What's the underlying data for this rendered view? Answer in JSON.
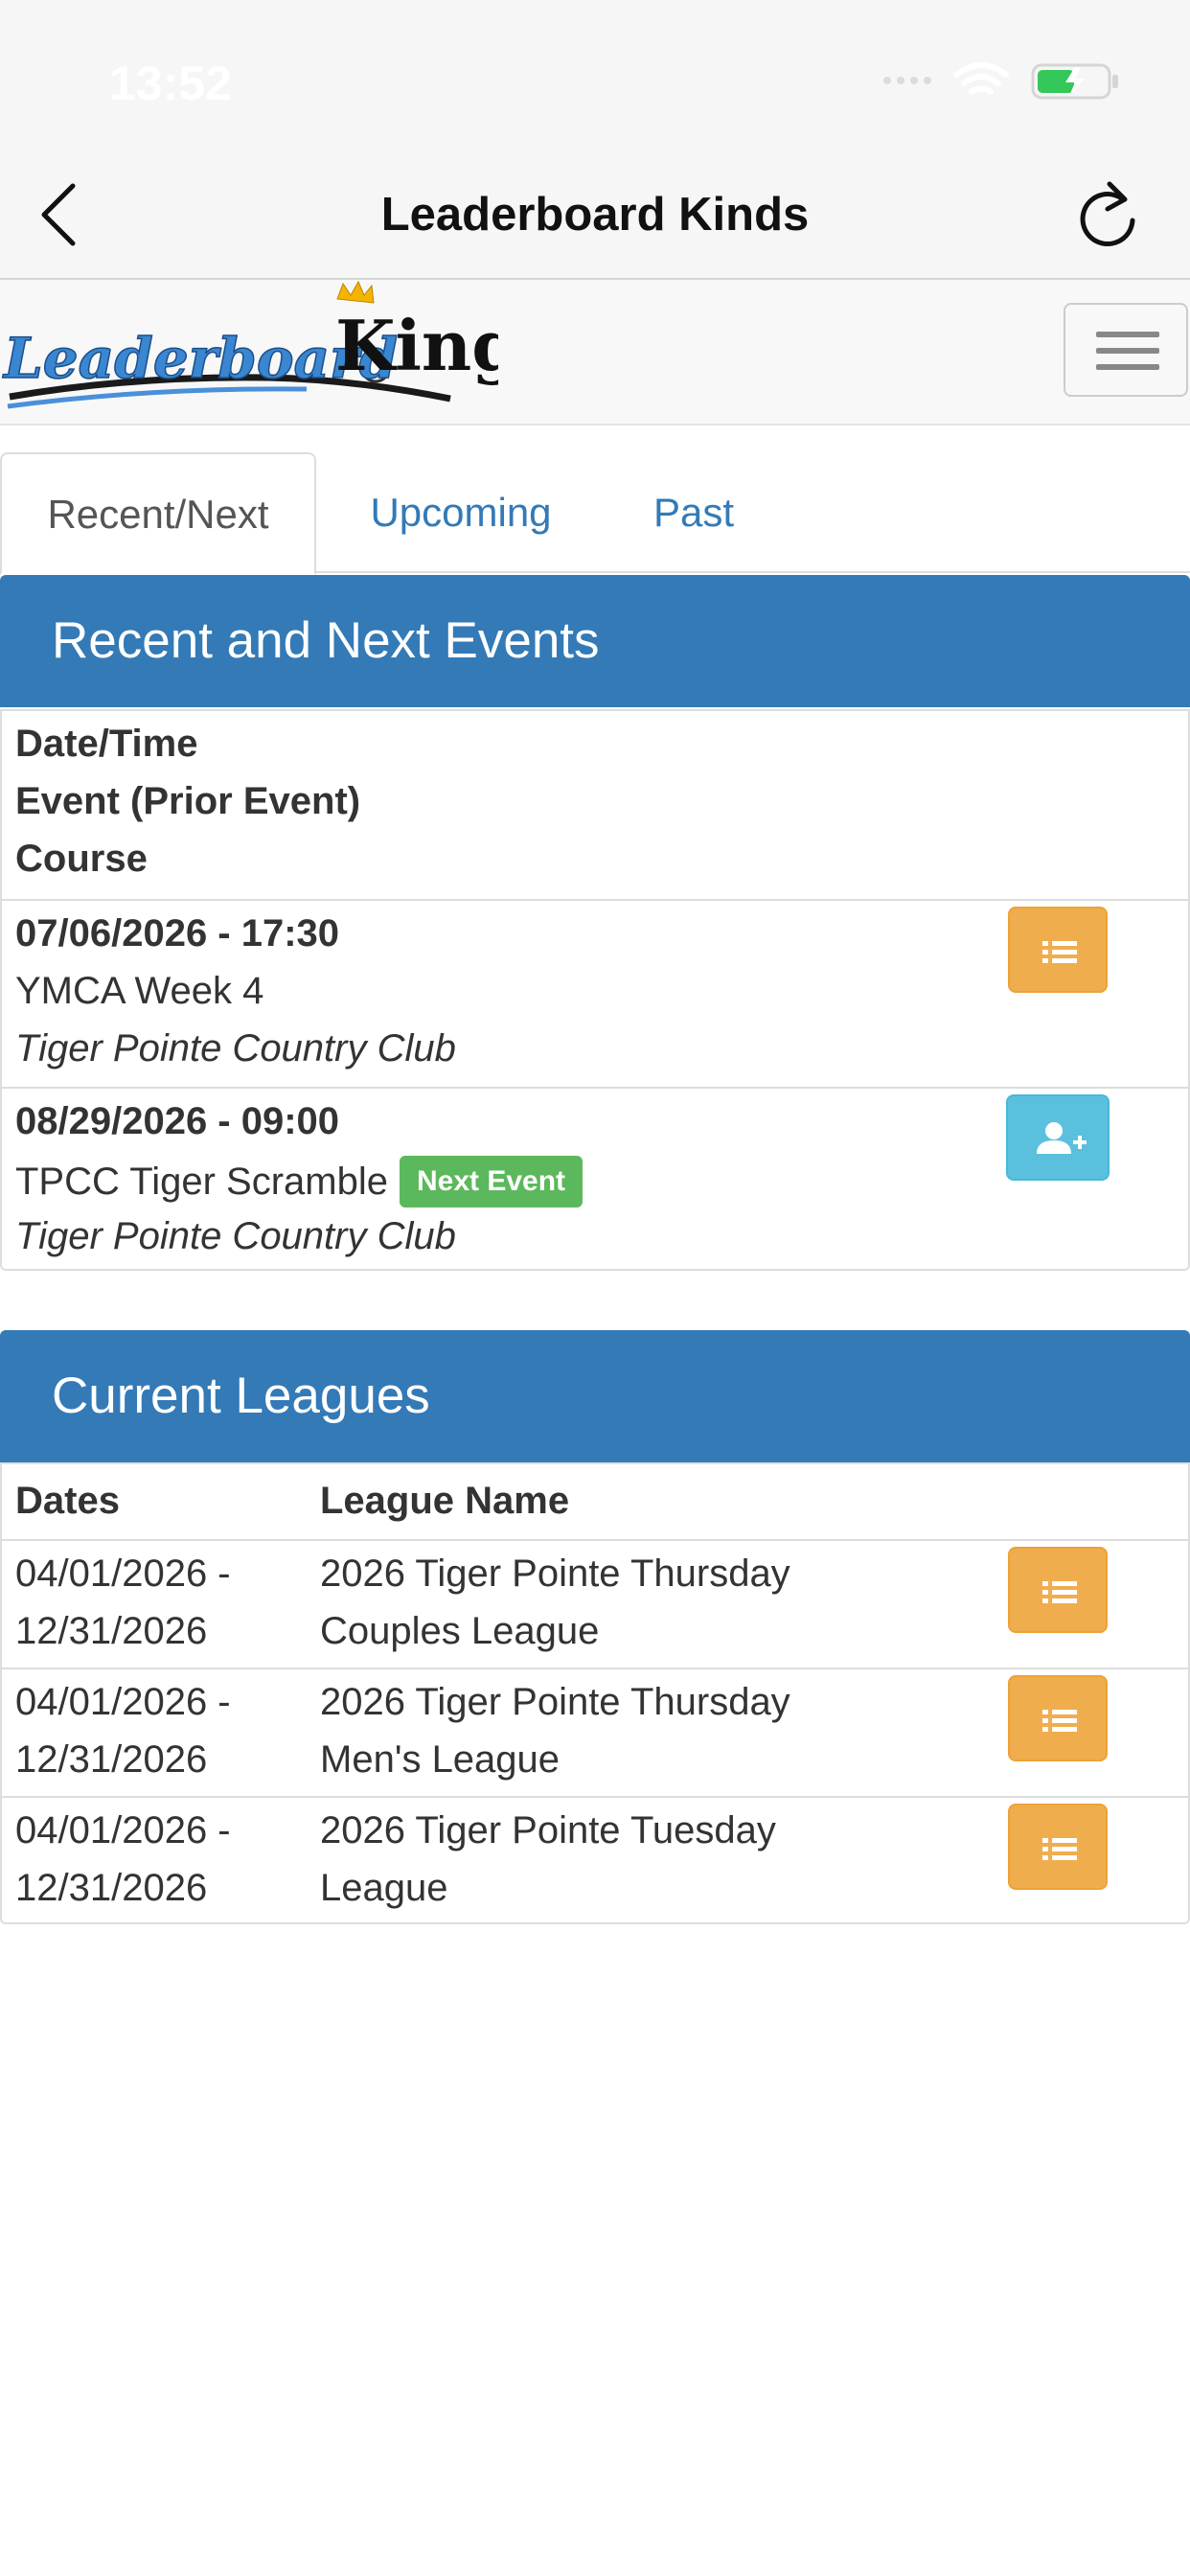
{
  "status_bar": {
    "time": "13:52"
  },
  "nav": {
    "title": "Leaderboard Kinds",
    "back_icon": "chevron-left-icon",
    "refresh_icon": "refresh-icon"
  },
  "header": {
    "logo_part1": "Leaderboard",
    "logo_part2": "King",
    "menu_icon": "hamburger-icon"
  },
  "tabs": [
    {
      "label": "Recent/Next",
      "active": true
    },
    {
      "label": "Upcoming",
      "active": false
    },
    {
      "label": "Past",
      "active": false
    }
  ],
  "events": {
    "heading": "Recent and Next Events",
    "header_lines": [
      "Date/Time",
      "Event (Prior Event)",
      "Course"
    ],
    "rows": [
      {
        "datetime": "07/06/2026 - 17:30",
        "event": "YMCA Week 4",
        "course": "Tiger Pointe Country Club",
        "badge": "",
        "action_icon": "list-icon"
      },
      {
        "datetime": "08/29/2026 - 09:00",
        "event": "TPCC Tiger Scramble",
        "course": "Tiger Pointe Country Club",
        "badge": "Next Event",
        "action_icon": "add-user-icon"
      }
    ]
  },
  "leagues": {
    "heading": "Current Leagues",
    "col_dates": "Dates",
    "col_name": "League Name",
    "rows": [
      {
        "date_start": "04/01/2026 -",
        "date_end": "12/31/2026",
        "name_line1": "2026 Tiger Pointe Thursday",
        "name_line2": "Couples League"
      },
      {
        "date_start": "04/01/2026 -",
        "date_end": "12/31/2026",
        "name_line1": "2026 Tiger Pointe Thursday",
        "name_line2": "Men's League"
      },
      {
        "date_start": "04/01/2026 -",
        "date_end": "12/31/2026",
        "name_line1": "2026 Tiger Pointe Tuesday",
        "name_line2": "League"
      }
    ]
  },
  "colors": {
    "primary": "#337ab7",
    "warning": "#f0ad4e",
    "info": "#5bc0de",
    "success": "#5cb85c",
    "link": "#337ab7"
  }
}
